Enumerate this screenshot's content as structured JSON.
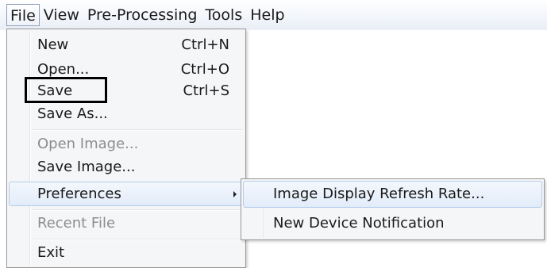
{
  "menubar": {
    "items": [
      {
        "label": "File",
        "active": true
      },
      {
        "label": "View"
      },
      {
        "label": "Pre-Processing"
      },
      {
        "label": "Tools"
      },
      {
        "label": "Help"
      }
    ]
  },
  "file_menu": {
    "new": {
      "label": "New",
      "shortcut": "Ctrl+N"
    },
    "open": {
      "label": "Open...",
      "shortcut": "Ctrl+O"
    },
    "save": {
      "label": "Save",
      "shortcut": "Ctrl+S",
      "annotated": true
    },
    "save_as": {
      "label": "Save As..."
    },
    "open_image": {
      "label": "Open Image...",
      "disabled": true
    },
    "save_image": {
      "label": "Save Image..."
    },
    "preferences": {
      "label": "Preferences",
      "has_submenu": true,
      "highlighted": true
    },
    "recent_file": {
      "label": "Recent File",
      "disabled": true
    },
    "exit": {
      "label": "Exit"
    }
  },
  "preferences_submenu": {
    "items": [
      {
        "label": "Image Display Refresh Rate...",
        "highlighted": true
      },
      {
        "label": "New Device Notification"
      }
    ]
  },
  "icons": {
    "submenu_arrow": "chevron-right-icon"
  }
}
